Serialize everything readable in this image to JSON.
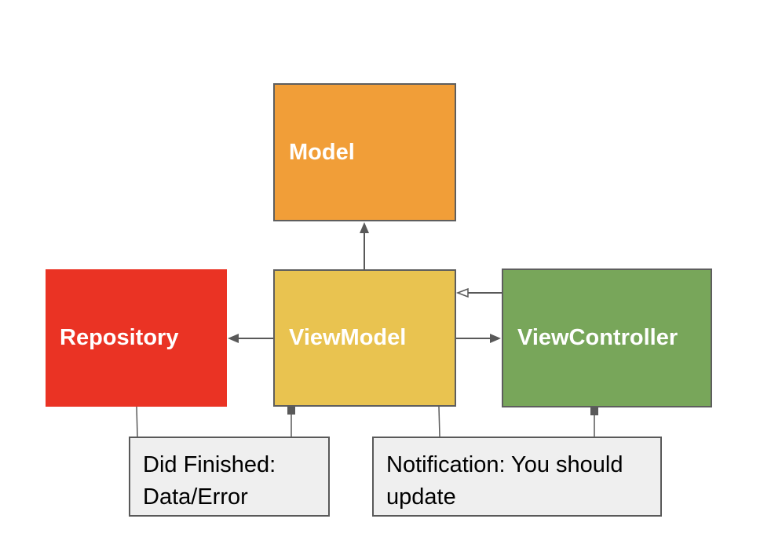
{
  "nodes": {
    "model": {
      "label": "Model"
    },
    "repository": {
      "label": "Repository"
    },
    "viewmodel": {
      "label": "ViewModel"
    },
    "viewcontroller": {
      "label": "ViewController"
    }
  },
  "notes": {
    "repository_callback": {
      "line1": "Did Finished:",
      "line2": "Data/Error"
    },
    "viewcontroller_notification": {
      "line1": "Notification: You should",
      "line2": "update"
    }
  },
  "colors": {
    "model": "#f19e38",
    "repository": "#ea3324",
    "viewmodel": "#e9c350",
    "viewcontroller": "#78a65a",
    "note_background": "#efefef",
    "connector": "#595959"
  }
}
